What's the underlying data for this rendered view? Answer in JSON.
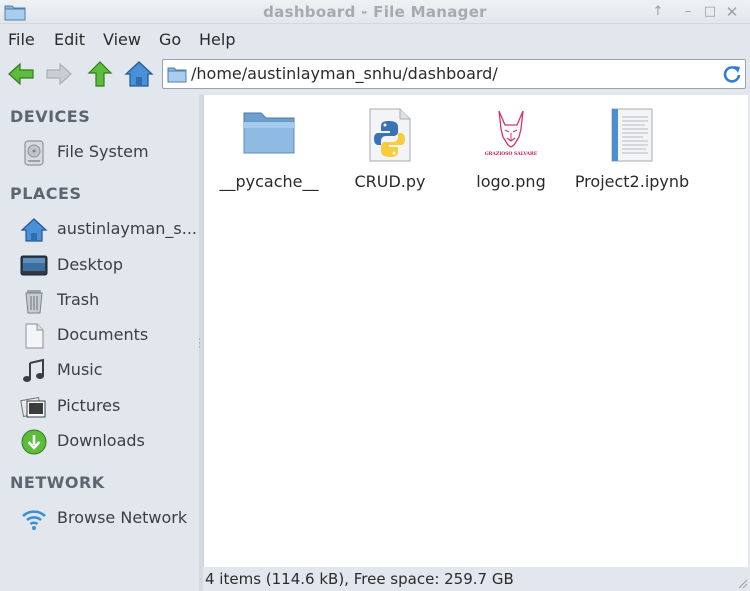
{
  "window": {
    "title": "dashboard - File Manager"
  },
  "menubar": {
    "items": [
      "File",
      "Edit",
      "View",
      "Go",
      "Help"
    ]
  },
  "toolbar": {
    "location": "/home/austinlayman_snhu/dashboard/"
  },
  "sidebar": {
    "devices_header": "DEVICES",
    "places_header": "PLACES",
    "network_header": "NETWORK",
    "devices": [
      {
        "label": "File System",
        "icon": "drive-icon"
      }
    ],
    "places": [
      {
        "label": "austinlayman_s...",
        "icon": "home-icon"
      },
      {
        "label": "Desktop",
        "icon": "desktop-icon"
      },
      {
        "label": "Trash",
        "icon": "trash-icon"
      },
      {
        "label": "Documents",
        "icon": "document-icon"
      },
      {
        "label": "Music",
        "icon": "music-icon"
      },
      {
        "label": "Pictures",
        "icon": "pictures-icon"
      },
      {
        "label": "Downloads",
        "icon": "download-icon"
      }
    ],
    "network": [
      {
        "label": "Browse Network",
        "icon": "wifi-icon"
      }
    ]
  },
  "files": [
    {
      "name": "__pycache__",
      "icon": "folder-icon"
    },
    {
      "name": "CRUD.py",
      "icon": "python-file-icon"
    },
    {
      "name": "logo.png",
      "icon": "image-file-icon"
    },
    {
      "name": "Project2.ipynb",
      "icon": "text-file-icon"
    }
  ],
  "logo_text": "GRAZIOSO SALVARE",
  "status": {
    "text": "4 items (114.6 kB), Free space: 259.7 GB"
  },
  "colors": {
    "accent": "#3b82c4",
    "nav_green": "#4caf2f",
    "folder_blue": "#7fb0dc"
  }
}
